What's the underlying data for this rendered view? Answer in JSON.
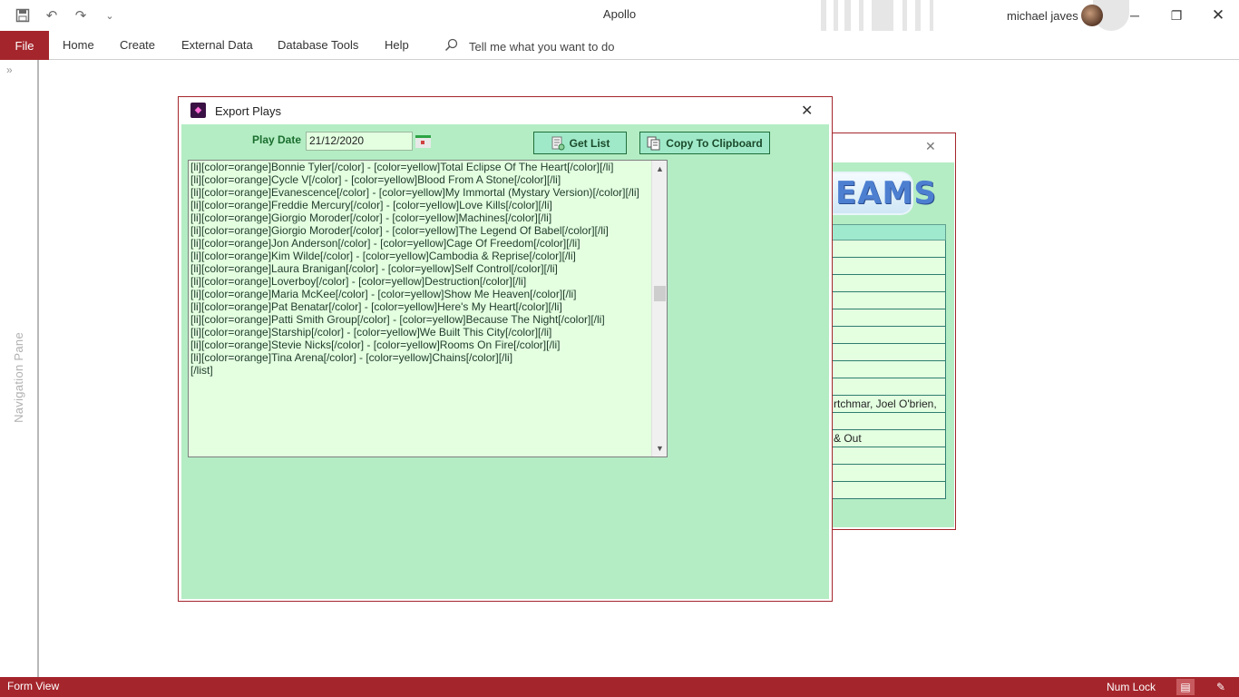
{
  "window": {
    "title": "Apollo",
    "user_name": "michael javes",
    "qat": {
      "save_icon": "save-icon",
      "undo_icon": "undo-icon",
      "redo_icon": "redo-icon",
      "customize_icon": "customize-qat-icon"
    }
  },
  "ribbon": {
    "file_label": "File",
    "tabs": [
      "Home",
      "Create",
      "External Data",
      "Database Tools",
      "Help"
    ],
    "tell_me_placeholder": "Tell me what you want to do"
  },
  "nav_pane": {
    "label": "Navigation Pane",
    "expand_glyph": "»"
  },
  "background_form": {
    "logo_text": "EAMS",
    "rows": [
      "",
      "",
      "",
      "",
      "",
      "",
      "",
      "",
      "",
      "rtchmar, Joel O'brien,",
      "",
      "& Out",
      "",
      "",
      ""
    ]
  },
  "dialog": {
    "title": "Export Plays",
    "play_date_label": "Play Date",
    "play_date_value": "21/12/2020",
    "get_list_label": "Get List",
    "copy_label": "Copy To Clipboard",
    "lines": [
      "[li][color=orange]Bonnie Tyler[/color] - [color=yellow]Total Eclipse Of The Heart[/color][/li]",
      "[li][color=orange]Cycle V[/color] - [color=yellow]Blood From A Stone[/color][/li]",
      "[li][color=orange]Evanescence[/color] - [color=yellow]My Immortal (Mystary Version)[/color][/li]",
      "[li][color=orange]Freddie Mercury[/color] - [color=yellow]Love Kills[/color][/li]",
      "[li][color=orange]Giorgio Moroder[/color] - [color=yellow]Machines[/color][/li]",
      "[li][color=orange]Giorgio Moroder[/color] - [color=yellow]The Legend Of Babel[/color][/li]",
      "[li][color=orange]Jon Anderson[/color] - [color=yellow]Cage Of Freedom[/color][/li]",
      "[li][color=orange]Kim Wilde[/color] - [color=yellow]Cambodia & Reprise[/color][/li]",
      "[li][color=orange]Laura Branigan[/color] - [color=yellow]Self Control[/color][/li]",
      "[li][color=orange]Loverboy[/color] - [color=yellow]Destruction[/color][/li]",
      "[li][color=orange]Maria McKee[/color] - [color=yellow]Show Me Heaven[/color][/li]",
      "[li][color=orange]Pat Benatar[/color] - [color=yellow]Here's My Heart[/color][/li]",
      "[li][color=orange]Patti Smith Group[/color] - [color=yellow]Because The Night[/color][/li]",
      "[li][color=orange]Starship[/color] - [color=yellow]We Built This City[/color][/li]",
      "[li][color=orange]Stevie Nicks[/color] - [color=yellow]Rooms On Fire[/color][/li]",
      "[li][color=orange]Tina Arena[/color] - [color=yellow]Chains[/color][/li]",
      "[/list]"
    ]
  },
  "status_bar": {
    "left_text": "Form View",
    "num_lock": "Num Lock"
  },
  "colors": {
    "accent": "#a4262c",
    "form_bg": "#b4edc4",
    "field_bg": "#e3ffe0",
    "button_bg": "#9fe9c9"
  }
}
